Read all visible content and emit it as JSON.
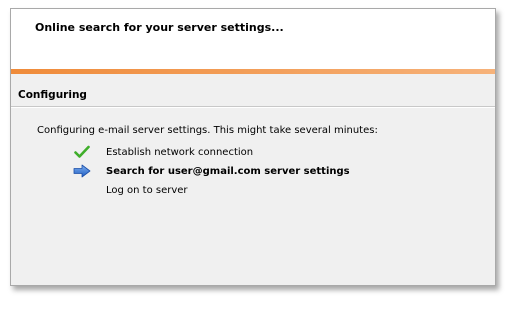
{
  "dialog": {
    "header_title": "Online search for your server settings...",
    "section_title": "Configuring",
    "description": "Configuring e-mail server settings. This might take several minutes:",
    "steps": [
      {
        "label": "Establish network connection",
        "status": "done",
        "icon": "checkmark-icon"
      },
      {
        "label": "Search for user@gmail.com server settings",
        "status": "in-progress",
        "icon": "arrow-right-icon"
      },
      {
        "label": "Log on to server",
        "status": "pending",
        "icon": ""
      }
    ]
  },
  "colors": {
    "accent_bar": "#ef8b3a",
    "check": "#3fae2a",
    "arrow": "#2f6fd0"
  }
}
